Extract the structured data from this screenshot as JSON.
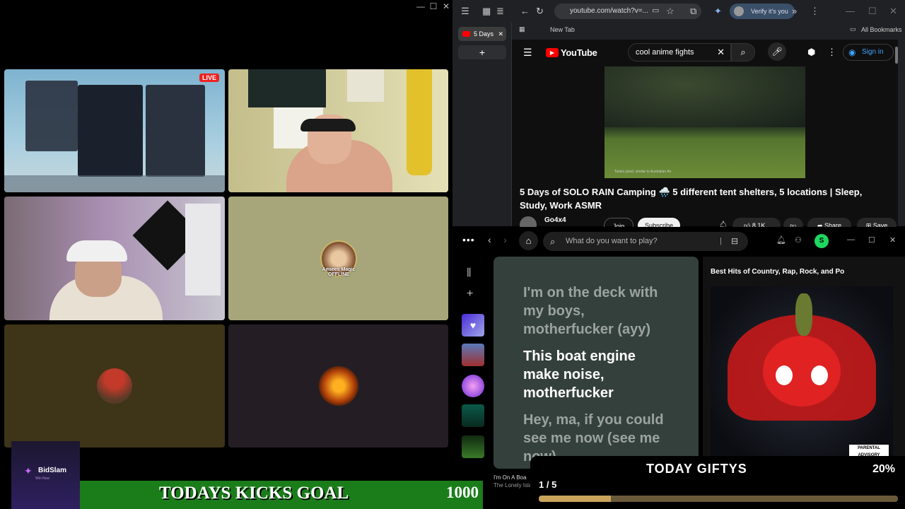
{
  "call": {
    "live_badge": "LIVE",
    "offline_avatar_text": "Amiees Magic OFFLINE",
    "window_controls": {
      "minimize": "—",
      "maximize": "☐",
      "close": "✕"
    }
  },
  "chrome": {
    "tab_title": "5 Days",
    "tab_close": "✕",
    "new_tab_plus": "+",
    "url": "youtube.com/watch?v=...",
    "verify_label": "Verify it's you",
    "new_tab_bookmark": "New Tab",
    "all_bookmarks": "All Bookmarks"
  },
  "youtube": {
    "logo_text": "YouTube",
    "search_value": "cool anime fights",
    "signin_label": "Sign in",
    "video_caption": "Tastes good, similar to Australian Air",
    "video_title": "5 Days of SOLO RAIN Camping 🌧️ 5 different tent shelters, 5 locations | Sleep, Study, Work ASMR",
    "channel": "Go4x4",
    "join_label": "Join",
    "subscribe_label": "Subscribe",
    "likes": "8.1K",
    "share_label": "Share",
    "save_label": "Save"
  },
  "spotify": {
    "search_placeholder": "What do you want to play?",
    "avatar_letter": "S",
    "lyrics": [
      {
        "text": "I'm on the deck with my boys, motherfucker (ayy)",
        "active": false
      },
      {
        "text": "This boat engine make noise, motherfucker",
        "active": true
      },
      {
        "text": "Hey, ma, if you could see me now (see me now)",
        "active": false
      }
    ],
    "playlist_title": "Best Hits of Country, Rap, Rock, and Po",
    "advisory_label": "PARENTAL ADVISORY",
    "now_playing_title": "I'm On A Boa",
    "now_playing_artist": "The Lonely Isla"
  },
  "overlays": {
    "gifty_title": "TODAY GIFTYS",
    "gifty_count": "1 / 5",
    "gifty_percent": "20%",
    "gifty_progress": 0.2,
    "kicks_title": "TODAYS KICKS GOAL",
    "kicks_goal": "1000",
    "bidslam_name": "BidSlam",
    "bidslam_sub": "Win Now"
  },
  "colors": {
    "spotify_green": "#1ed760",
    "youtube_red": "#ff0000",
    "kicks_green": "#1a7d1a",
    "gifty_bar": "#c8a45a"
  }
}
